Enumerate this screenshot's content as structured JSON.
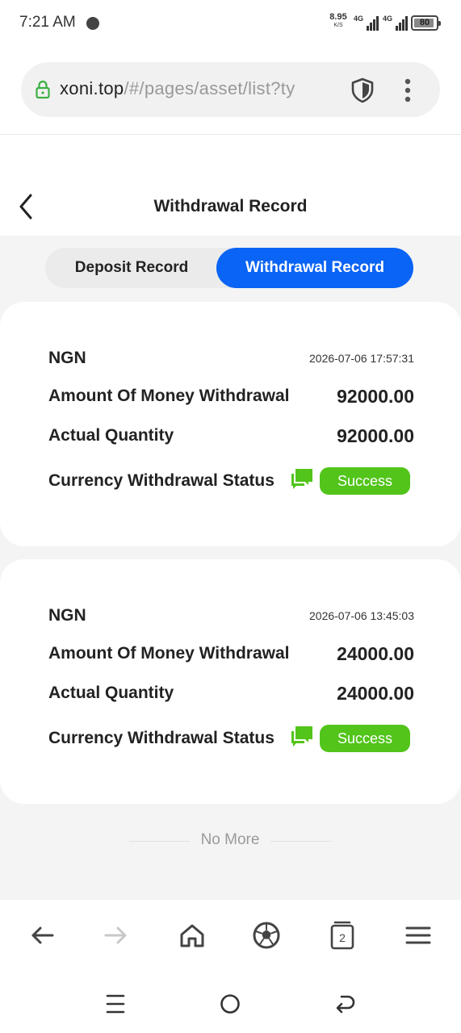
{
  "status_bar": {
    "time": "7:21 AM",
    "net_speed_value": "8.95",
    "net_speed_unit": "K/S",
    "network_1": "4G",
    "network_2": "4G",
    "battery": "80"
  },
  "browser": {
    "url_host": "xoni.top",
    "url_path": "/#/pages/asset/list?ty",
    "tab_count": "2"
  },
  "header": {
    "title": "Withdrawal Record"
  },
  "tabs": [
    {
      "label": "Deposit Record",
      "active": false
    },
    {
      "label": "Withdrawal Record",
      "active": true
    }
  ],
  "records": [
    {
      "currency": "NGN",
      "time": "2026-07-06 17:57:31",
      "amount_label": "Amount Of Money Withdrawal",
      "amount": "92000.00",
      "actual_label": "Actual Quantity",
      "actual": "92000.00",
      "status_label": "Currency Withdrawal Status",
      "status": "Success"
    },
    {
      "currency": "NGN",
      "time": "2026-07-06 13:45:03",
      "amount_label": "Amount Of Money Withdrawal",
      "amount": "24000.00",
      "actual_label": "Actual Quantity",
      "actual": "24000.00",
      "status_label": "Currency Withdrawal Status",
      "status": "Success"
    }
  ],
  "footer": {
    "no_more": "No More"
  },
  "colors": {
    "accent": "#0a64f5",
    "success": "#52c41a",
    "page_bg": "#f4f4f4"
  },
  "icons": {
    "back": "back-arrow-icon",
    "lock": "lock-icon",
    "shield": "shield-icon",
    "menu": "menu-dots-icon",
    "chat": "chat-icon"
  }
}
